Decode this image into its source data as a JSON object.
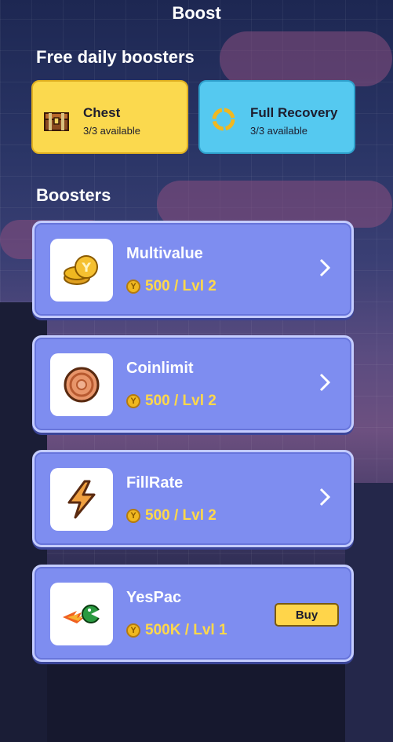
{
  "header": {
    "title": "Boost"
  },
  "free_section": {
    "title": "Free daily boosters",
    "cards": [
      {
        "name": "Chest",
        "availability": "3/3 available",
        "icon": "chest-icon",
        "color": "#fbd94e"
      },
      {
        "name": "Full Recovery",
        "availability": "3/3 available",
        "icon": "recovery-icon",
        "color": "#55c9f0"
      }
    ]
  },
  "boosters_section": {
    "title": "Boosters",
    "items": [
      {
        "name": "Multivalue",
        "price": "500 / Lvl 2",
        "icon": "coins-icon",
        "action": "chevron-right-icon"
      },
      {
        "name": "Coinlimit",
        "price": "500 / Lvl 2",
        "icon": "coin-disc-icon",
        "action": "chevron-right-icon"
      },
      {
        "name": "FillRate",
        "price": "500 / Lvl 2",
        "icon": "lightning-icon",
        "action": "chevron-right-icon"
      },
      {
        "name": "YesPac",
        "price": "500K / Lvl 1",
        "icon": "pacman-fire-icon",
        "action_label": "Buy"
      }
    ]
  },
  "currency": {
    "icon": "coin-icon",
    "glyph": "Y"
  }
}
